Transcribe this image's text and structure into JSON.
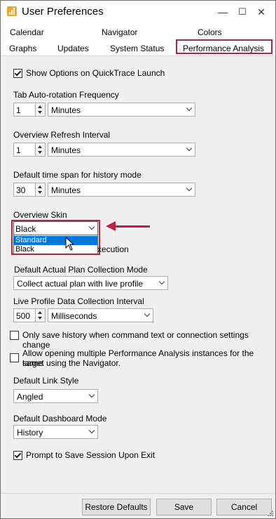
{
  "window": {
    "title": "User Preferences",
    "minimize_label": "—",
    "maximize_label": "☐",
    "close_label": "✕"
  },
  "tabs": {
    "row1": [
      "Calendar",
      "Navigator",
      "Colors"
    ],
    "row2": [
      "Graphs",
      "Updates",
      "System Status",
      "Performance Analysis"
    ],
    "active": "Performance Analysis"
  },
  "settings": {
    "show_options": {
      "label": "Show Options on QuickTrace Launch",
      "checked": true
    },
    "tab_rotation": {
      "label": "Tab Auto-rotation Frequency",
      "value": "1",
      "unit": "Minutes"
    },
    "overview_refresh": {
      "label": "Overview Refresh Interval",
      "value": "1",
      "unit": "Minutes"
    },
    "history_span": {
      "label": "Default time span for history mode",
      "value": "30",
      "unit": "Minutes"
    },
    "overview_skin": {
      "label": "Overview Skin",
      "value": "Black",
      "options": [
        "Standard",
        "Black"
      ],
      "highlighted": "Standard"
    },
    "partial_behind": "xecution",
    "plan_mode": {
      "label": "Default Actual Plan Collection Mode",
      "value": "Collect actual plan with live profile"
    },
    "live_profile": {
      "label": "Live Profile Data Collection Interval",
      "value": "500",
      "unit": "Milliseconds"
    },
    "only_save_history": {
      "label": "Only save history when command text or connection settings change",
      "checked": false
    },
    "allow_multiple": {
      "label_line1": "Allow opening multiple Performance Analysis instances for the same",
      "label_line2": "target using the Navigator.",
      "checked": false
    },
    "link_style": {
      "label": "Default Link Style",
      "value": "Angled"
    },
    "dashboard_mode": {
      "label": "Default Dashboard Mode",
      "value": "History"
    },
    "prompt_save": {
      "label": "Prompt to Save Session Upon Exit",
      "checked": true
    }
  },
  "buttons": {
    "restore": "Restore Defaults",
    "save": "Save",
    "cancel": "Cancel"
  },
  "colors": {
    "highlight": "#b4243a",
    "selection": "#0078d7"
  }
}
